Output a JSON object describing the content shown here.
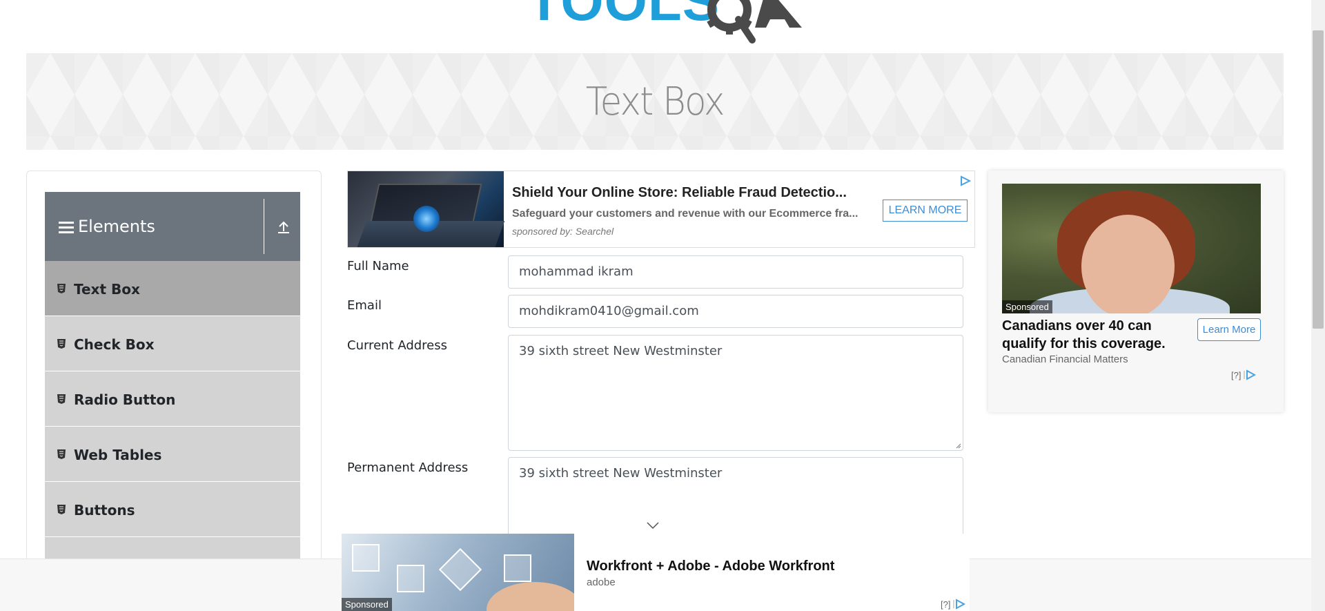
{
  "logo": {
    "text": "TOOLS"
  },
  "page": {
    "title": "Text Box"
  },
  "sidebar": {
    "group_title": "Elements",
    "items": [
      {
        "label": "Text Box",
        "active": true
      },
      {
        "label": "Check Box"
      },
      {
        "label": "Radio Button"
      },
      {
        "label": "Web Tables"
      },
      {
        "label": "Buttons"
      }
    ]
  },
  "ad_top": {
    "headline": "Shield Your Online Store: Reliable Fraud Detectio...",
    "description": "Safeguard your customers and revenue with our Ecommerce fra...",
    "sponsor": "sponsored by: Searchel",
    "cta": "LEARN MORE"
  },
  "form": {
    "full_name": {
      "label": "Full Name",
      "value": "mohammad ikram"
    },
    "email": {
      "label": "Email",
      "value": "mohdikram0410@gmail.com"
    },
    "current_address": {
      "label": "Current Address",
      "value": "39 sixth street New Westminster"
    },
    "permanent_address": {
      "label": "Permanent Address",
      "value": "39 sixth street New Westminster"
    }
  },
  "ad_right": {
    "badge": "Sponsored",
    "headline": "Canadians over 40 can qualify for this coverage.",
    "source": "Canadian Financial Matters",
    "cta": "Learn More",
    "info": "[?]"
  },
  "ad_bottom": {
    "badge": "Sponsored",
    "headline": "Workfront + Adobe - Adobe Workfront",
    "source": "adobe",
    "info": "[?]"
  },
  "colors": {
    "accent": "#1f9fd9",
    "group_header": "#6c757d",
    "menu_item": "#d3d3d3",
    "menu_item_active": "#a9a9a9",
    "ad_link": "#3c8dd7"
  }
}
